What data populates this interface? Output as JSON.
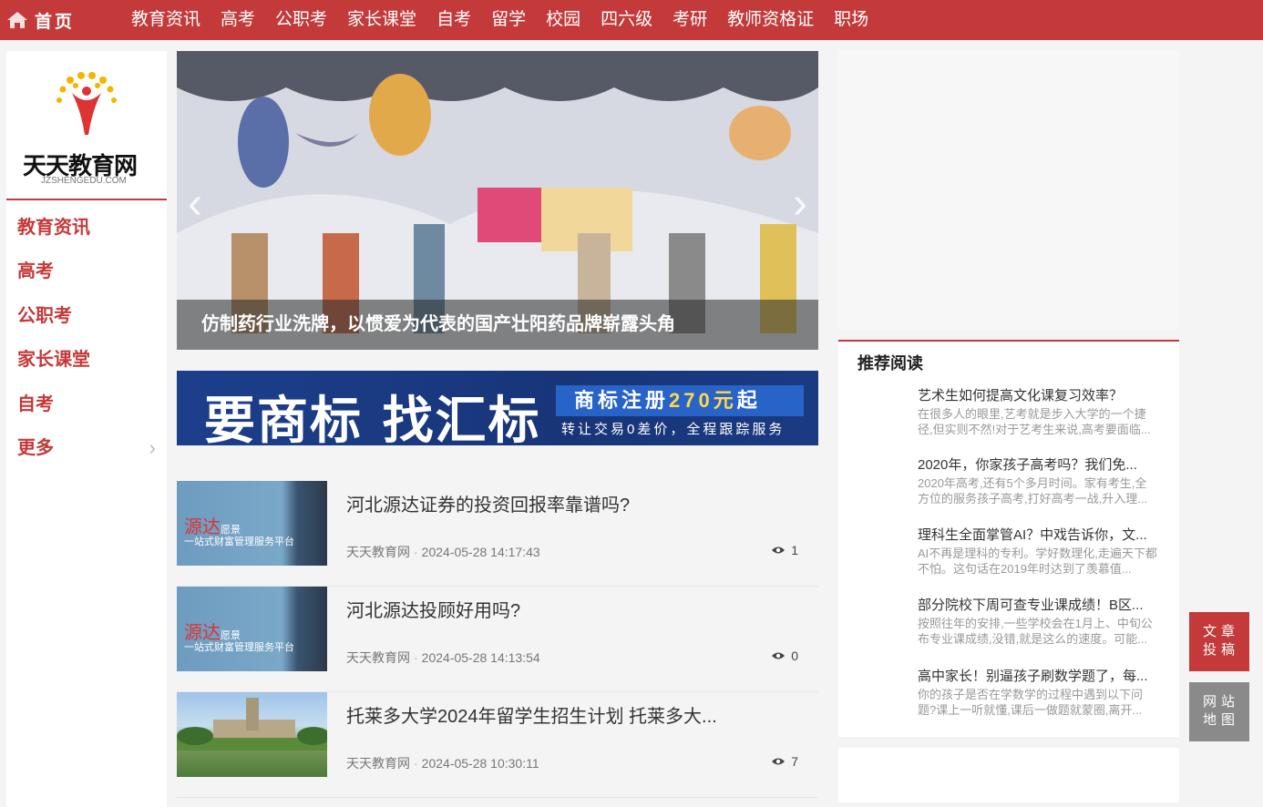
{
  "header": {
    "home_label": "首页",
    "nav": [
      "教育资讯",
      "高考",
      "公职考",
      "家长课堂",
      "自考",
      "留学",
      "校园",
      "四六级",
      "考研",
      "教师资格证",
      "职场"
    ]
  },
  "sidebar": {
    "logo_name": "天天教育网",
    "logo_domain": "JZSHENGEDU.COM",
    "items": [
      "教育资讯",
      "高考",
      "公职考",
      "家长课堂",
      "自考",
      "更多"
    ]
  },
  "slider": {
    "caption": "仿制药行业洗牌，以惯爱为代表的国产壮阳药品牌崭露头角"
  },
  "banner": {
    "big_text": "要商标 找汇标",
    "pill_prefix": "商标注册",
    "pill_price": "270元",
    "pill_suffix": "起",
    "sub_text": "转让交易0差价，全程跟踪服务"
  },
  "articles": [
    {
      "title": "河北源达证券的投资回报率靠谱吗?",
      "source": "天天教育网",
      "time": "2024-05-28 14:17:43",
      "views": "1",
      "thumb_brand": "源达",
      "thumb_brand_suffix": "愿景",
      "thumb_tagline": "一站式财富管理服务平台"
    },
    {
      "title": "河北源达投顾好用吗?",
      "source": "天天教育网",
      "time": "2024-05-28 14:13:54",
      "views": "0",
      "thumb_brand": "源达",
      "thumb_brand_suffix": "愿景",
      "thumb_tagline": "一站式财富管理服务平台"
    },
    {
      "title": "托莱多大学2024年留学生招生计划 托莱多大...",
      "source": "天天教育网",
      "time": "2024-05-28 10:30:11",
      "views": "7"
    }
  ],
  "recommend": {
    "heading": "推荐阅读",
    "items": [
      {
        "title": "艺术生如何提高文化课复习效率？",
        "desc": "在很多人的眼里,艺考就是步入大学的一个捷径,但实则不然!对于艺考生来说,高考要面临..."
      },
      {
        "title": "2020年，你家孩子高考吗？我们免...",
        "desc": "2020年高考,还有5个多月时间。家有考生,全方位的服务孩子高考,打好高考一战,升入理..."
      },
      {
        "title": "理科生全面掌管AI？中戏告诉你，文...",
        "desc": "AI不再是理科的专利。学好数理化,走遍天下都不怕。这句话在2019年时达到了羡慕值..."
      },
      {
        "title": "部分院校下周可查专业课成绩！B区...",
        "desc": "按照往年的安排,一些学校会在1月上、中旬公布专业课成绩,没错,就是这么的速度。可能..."
      },
      {
        "title": "高中家长！别逼孩子刷数学题了，每...",
        "desc": "你的孩子是否在学数学的过程中遇到以下问题?课上一听就懂,课后一做题就蒙圈,离开..."
      }
    ]
  },
  "float_buttons": {
    "submit_line1": "文章",
    "submit_line2": "投稿",
    "sitemap_line1": "网站",
    "sitemap_line2": "地图"
  },
  "colors": {
    "brand": "#c43a3a",
    "banner_blue": "#1c3f8c"
  }
}
